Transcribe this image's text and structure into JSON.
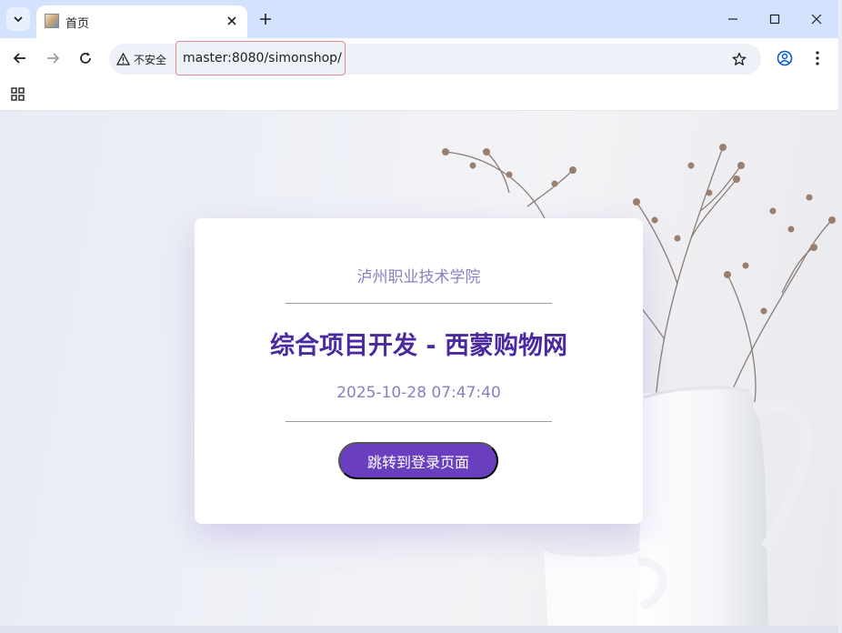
{
  "browser": {
    "tab": {
      "title": "首页"
    },
    "address": {
      "security_label": "不安全",
      "url": "master:8080/simonshop/"
    }
  },
  "page": {
    "school": "泸州职业技术学院",
    "title": "综合项目开发 - 西蒙购物网",
    "datetime": "2025-10-28 07:47:40",
    "login_button": "跳转到登录页面"
  },
  "colors": {
    "accent": "#6a3fbf",
    "title": "#4b2aa0",
    "subtle_text": "#8a7fc0",
    "tabstrip": "#d3e3fd"
  },
  "icons": [
    "chevron-down-icon",
    "page-favicon-icon",
    "close-icon",
    "plus-icon",
    "minimize-icon",
    "maximize-icon",
    "window-close-icon",
    "back-arrow-icon",
    "forward-arrow-icon",
    "reload-icon",
    "warning-icon",
    "star-icon",
    "profile-icon",
    "more-vert-icon",
    "apps-grid-icon"
  ]
}
